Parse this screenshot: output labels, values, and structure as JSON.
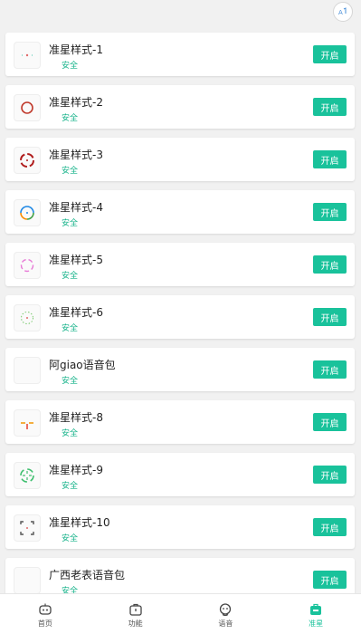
{
  "colors": {
    "accent": "#19c29b",
    "safe": "#16b38a"
  },
  "top_icon": "translate-icon",
  "items": [
    {
      "title": "准星样式-1",
      "status": "安全",
      "button": "开启",
      "icon": "crosshair-style-1-icon"
    },
    {
      "title": "准星样式-2",
      "status": "安全",
      "button": "开启",
      "icon": "crosshair-style-2-icon"
    },
    {
      "title": "准星样式-3",
      "status": "安全",
      "button": "开启",
      "icon": "crosshair-style-3-icon"
    },
    {
      "title": "准星样式-4",
      "status": "安全",
      "button": "开启",
      "icon": "crosshair-style-4-icon"
    },
    {
      "title": "准星样式-5",
      "status": "安全",
      "button": "开启",
      "icon": "crosshair-style-5-icon"
    },
    {
      "title": "准星样式-6",
      "status": "安全",
      "button": "开启",
      "icon": "crosshair-style-6-icon"
    },
    {
      "title": "阿giao语音包",
      "status": "安全",
      "button": "开启",
      "icon": "voice-pack-icon"
    },
    {
      "title": "准星样式-8",
      "status": "安全",
      "button": "开启",
      "icon": "crosshair-style-8-icon"
    },
    {
      "title": "准星样式-9",
      "status": "安全",
      "button": "开启",
      "icon": "crosshair-style-9-icon"
    },
    {
      "title": "准星样式-10",
      "status": "安全",
      "button": "开启",
      "icon": "crosshair-style-10-icon"
    },
    {
      "title": "广西老表语音包",
      "status": "安全",
      "button": "开启",
      "icon": "voice-pack-icon"
    }
  ],
  "nav": [
    {
      "label": "首页",
      "icon": "robot-icon",
      "active": false
    },
    {
      "label": "功能",
      "icon": "toolbox-icon",
      "active": false
    },
    {
      "label": "语音",
      "icon": "face-icon",
      "active": false
    },
    {
      "label": "准星",
      "icon": "crosshair-bag-icon",
      "active": true
    }
  ]
}
